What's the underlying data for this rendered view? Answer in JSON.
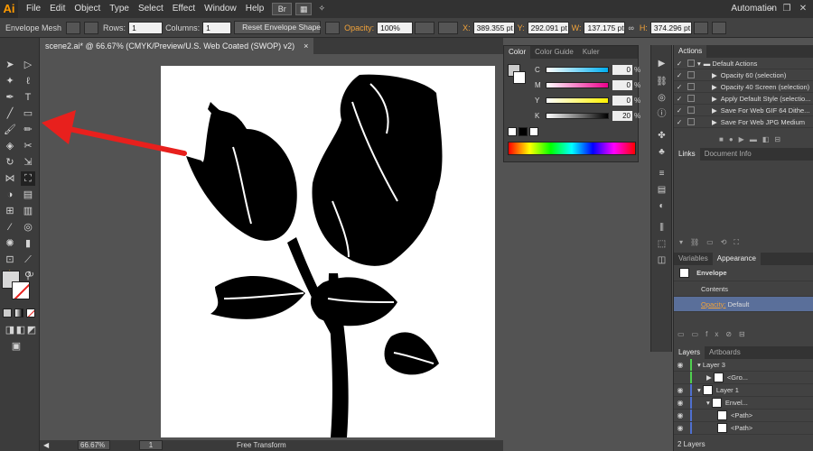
{
  "app": {
    "logo": "Ai",
    "workspace": "Automation",
    "colors": {
      "accent": "#ff9a00",
      "arrow": "#e8201d",
      "selection_bar": "#5a6f9a"
    }
  },
  "menu": [
    "File",
    "Edit",
    "Object",
    "Type",
    "Select",
    "Effect",
    "Window",
    "Help"
  ],
  "control": {
    "mode": "Envelope Mesh",
    "rows_label": "Rows:",
    "rows": "1",
    "columns_label": "Columns:",
    "columns": "1",
    "reset_button": "Reset Envelope Shape",
    "opacity_label": "Opacity:",
    "opacity": "100%",
    "x_label": "X:",
    "x": "389.355 pt",
    "y_label": "Y:",
    "y": "292.091 pt",
    "w_label": "W:",
    "w": "137.175 pt",
    "h_label": "H:",
    "h": "374.296 pt"
  },
  "document": {
    "tab": "scene2.ai* @ 66.67% (CMYK/Preview/U.S. Web Coated (SWOP) v2)",
    "close": "×"
  },
  "status": {
    "zoom": "66.67%",
    "page": "1",
    "tool": "Free Transform"
  },
  "color_panel": {
    "tabs": [
      "Color",
      "Color Guide",
      "Kuler"
    ],
    "sliders": [
      {
        "label": "C",
        "value": "0",
        "color": "#00aeef"
      },
      {
        "label": "M",
        "value": "0",
        "color": "#ec008c"
      },
      {
        "label": "Y",
        "value": "0",
        "color": "#fff200"
      },
      {
        "label": "K",
        "value": "20",
        "color": "#000000"
      }
    ],
    "unit": "%"
  },
  "actions_panel": {
    "title": "Actions",
    "items": [
      "Default Actions",
      "Opacity 60 (selection)",
      "Opacity 40 Screen (selection)",
      "Apply Default Style (selectio...",
      "Save For Web GIF 64 Dithe...",
      "Save For Web JPG Medium"
    ]
  },
  "links_panel": {
    "tabs": [
      "Links",
      "Document Info"
    ]
  },
  "appearance_panel": {
    "tabs": [
      "Variables",
      "Appearance"
    ],
    "object": "Envelope",
    "contents": "Contents",
    "opacity_label": "Opacity:",
    "opacity_value": "Default"
  },
  "layers_panel": {
    "tabs": [
      "Layers",
      "Artboards"
    ],
    "rows": [
      "Layer 3",
      "<Gro...",
      "Layer 1",
      "Envel...",
      "<Path>",
      "<Path>"
    ],
    "footer": "2 Layers"
  }
}
